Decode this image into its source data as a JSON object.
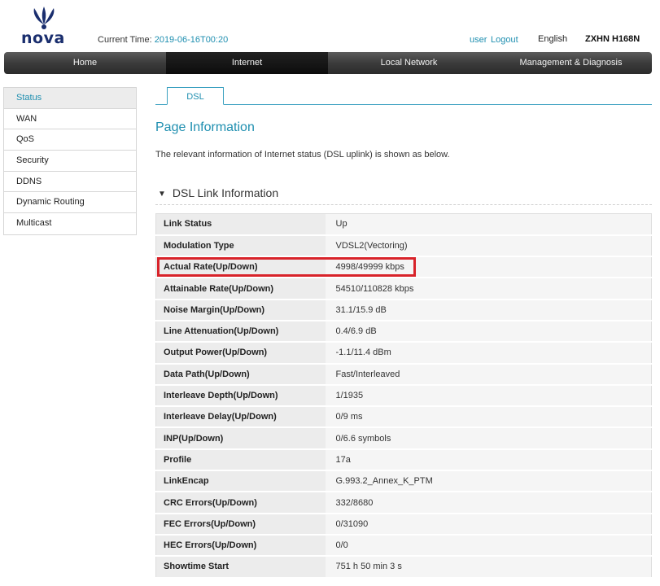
{
  "header": {
    "logo_text": "nova",
    "current_time_label": "Current Time:",
    "current_time_value": "2019-06-16T00:20",
    "user_link": "user",
    "logout_link": "Logout",
    "language": "English",
    "device_model": "ZXHN H168N"
  },
  "nav": {
    "items": [
      "Home",
      "Internet",
      "Local Network",
      "Management & Diagnosis"
    ],
    "active": "Internet"
  },
  "sidebar": {
    "items": [
      "Status",
      "WAN",
      "QoS",
      "Security",
      "DDNS",
      "Dynamic Routing",
      "Multicast"
    ],
    "active": "Status"
  },
  "tab": {
    "label": "DSL"
  },
  "page": {
    "title": "Page Information",
    "description": "The relevant information of Internet status (DSL uplink) is shown as below."
  },
  "section": {
    "title": "DSL Link Information",
    "rows": [
      {
        "label": "Link Status",
        "value": "Up"
      },
      {
        "label": "Modulation Type",
        "value": "VDSL2(Vectoring)"
      },
      {
        "label": "Actual Rate(Up/Down)",
        "value": "4998/49999 kbps"
      },
      {
        "label": "Attainable Rate(Up/Down)",
        "value": "54510/110828 kbps"
      },
      {
        "label": "Noise Margin(Up/Down)",
        "value": "31.1/15.9 dB"
      },
      {
        "label": "Line Attenuation(Up/Down)",
        "value": "0.4/6.9 dB"
      },
      {
        "label": "Output Power(Up/Down)",
        "value": "-1.1/11.4 dBm"
      },
      {
        "label": "Data Path(Up/Down)",
        "value": "Fast/Interleaved"
      },
      {
        "label": "Interleave Depth(Up/Down)",
        "value": "1/1935"
      },
      {
        "label": "Interleave Delay(Up/Down)",
        "value": "0/9 ms"
      },
      {
        "label": "INP(Up/Down)",
        "value": "0/6.6 symbols"
      },
      {
        "label": "Profile",
        "value": "17a"
      },
      {
        "label": "LinkEncap",
        "value": "G.993.2_Annex_K_PTM"
      },
      {
        "label": "CRC Errors(Up/Down)",
        "value": "332/8680"
      },
      {
        "label": "FEC Errors(Up/Down)",
        "value": "0/31090"
      },
      {
        "label": "HEC Errors(Up/Down)",
        "value": "0/0"
      },
      {
        "label": "Showtime Start",
        "value": "751 h 50 min 3 s"
      }
    ]
  },
  "colors": {
    "accent": "#1f8fb0",
    "highlight": "#d8232a",
    "logo": "#1a2e6e"
  }
}
